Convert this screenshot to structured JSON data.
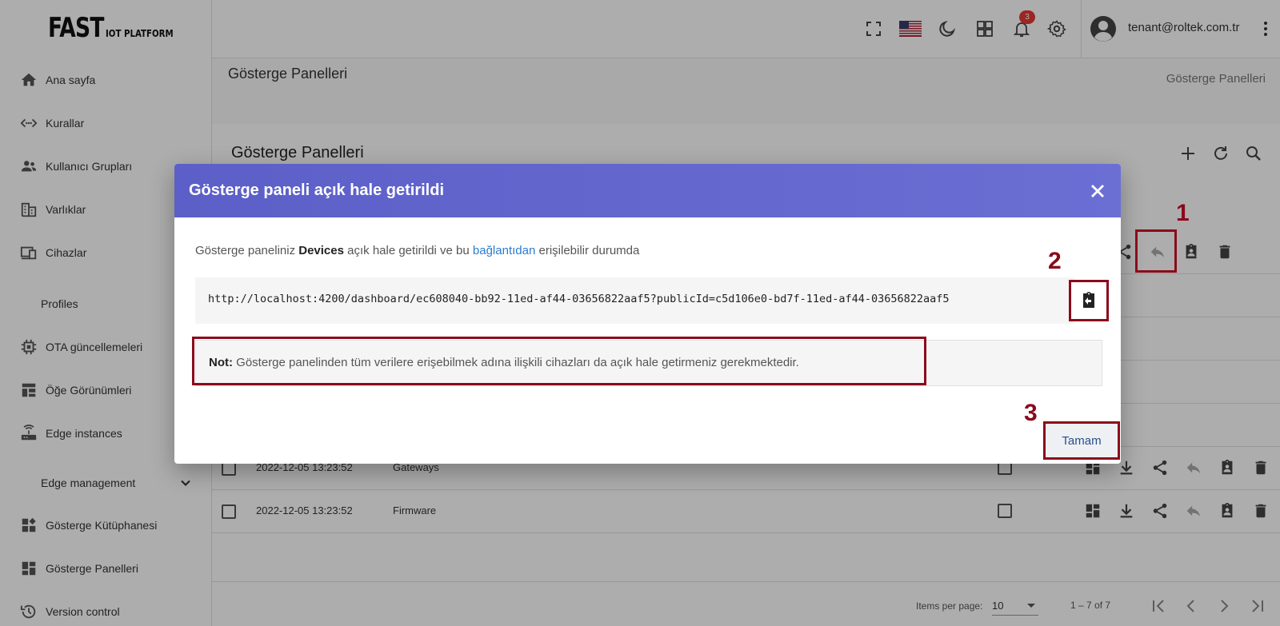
{
  "sidebar": {
    "logo_main": "FAST",
    "logo_sub": "IOT PLATFORM",
    "items": [
      {
        "label": "Ana sayfa",
        "icon": "home-icon"
      },
      {
        "label": "Kurallar",
        "icon": "rule-chain-icon"
      },
      {
        "label": "Kullanıcı Grupları",
        "icon": "users-icon"
      },
      {
        "label": "Varlıklar",
        "icon": "building-icon"
      },
      {
        "label": "Cihazlar",
        "icon": "devices-icon"
      },
      {
        "label": "Profiles",
        "icon": ""
      },
      {
        "label": "OTA güncellemeleri",
        "icon": "chip-icon"
      },
      {
        "label": "Öğe Görünümleri",
        "icon": "widgets-icon"
      },
      {
        "label": "Edge instances",
        "icon": "router-icon"
      },
      {
        "label": "Edge management",
        "icon": "chevron-down-icon"
      },
      {
        "label": "Gösterge Kütüphanesi",
        "icon": "dashboard-library-icon"
      },
      {
        "label": "Gösterge Panelleri",
        "icon": "dashboard-icon"
      },
      {
        "label": "Version control",
        "icon": "history-icon"
      }
    ]
  },
  "header": {
    "notification_count": "3",
    "user_email": "tenant@roltek.com.tr"
  },
  "page": {
    "title": "Gösterge Panelleri",
    "breadcrumb": "Gösterge Panelleri",
    "card_title": "Gösterge Panelleri"
  },
  "table": {
    "rows": [
      {
        "created": "2022-12-05 13:23:52",
        "title": "Gateways"
      },
      {
        "created": "2022-12-05 13:23:52",
        "title": "Firmware"
      }
    ]
  },
  "paginator": {
    "items_per_page_label": "Items per page:",
    "page_size": "10",
    "range": "1 – 7 of 7"
  },
  "dialog": {
    "title": "Gösterge paneli açık hale getirildi",
    "msg_prefix": "Gösterge paneliniz",
    "msg_name": "Devices",
    "msg_middle": "açık hale getirildi ve bu",
    "msg_link": "bağlantıdan",
    "msg_suffix": "erişilebilir durumda",
    "url": "http://localhost:4200/dashboard/ec608040-bb92-11ed-af44-03656822aaf5?publicId=c5d106e0-bd7f-11ed-af44-03656822aaf5",
    "note_label": "Not:",
    "note_text": "Gösterge panelinden tüm verilere erişebilmek adına ilişkili cihazları da açık hale getirmeniz gerekmektedir.",
    "ok_label": "Tamam"
  },
  "annotations": {
    "step1": "1",
    "step2": "2",
    "step3": "3"
  },
  "colors": {
    "dialog_header": "#5b5fc7",
    "annotation": "#8b0a1a",
    "link": "#2a7bd0",
    "badge": "#e53935"
  }
}
